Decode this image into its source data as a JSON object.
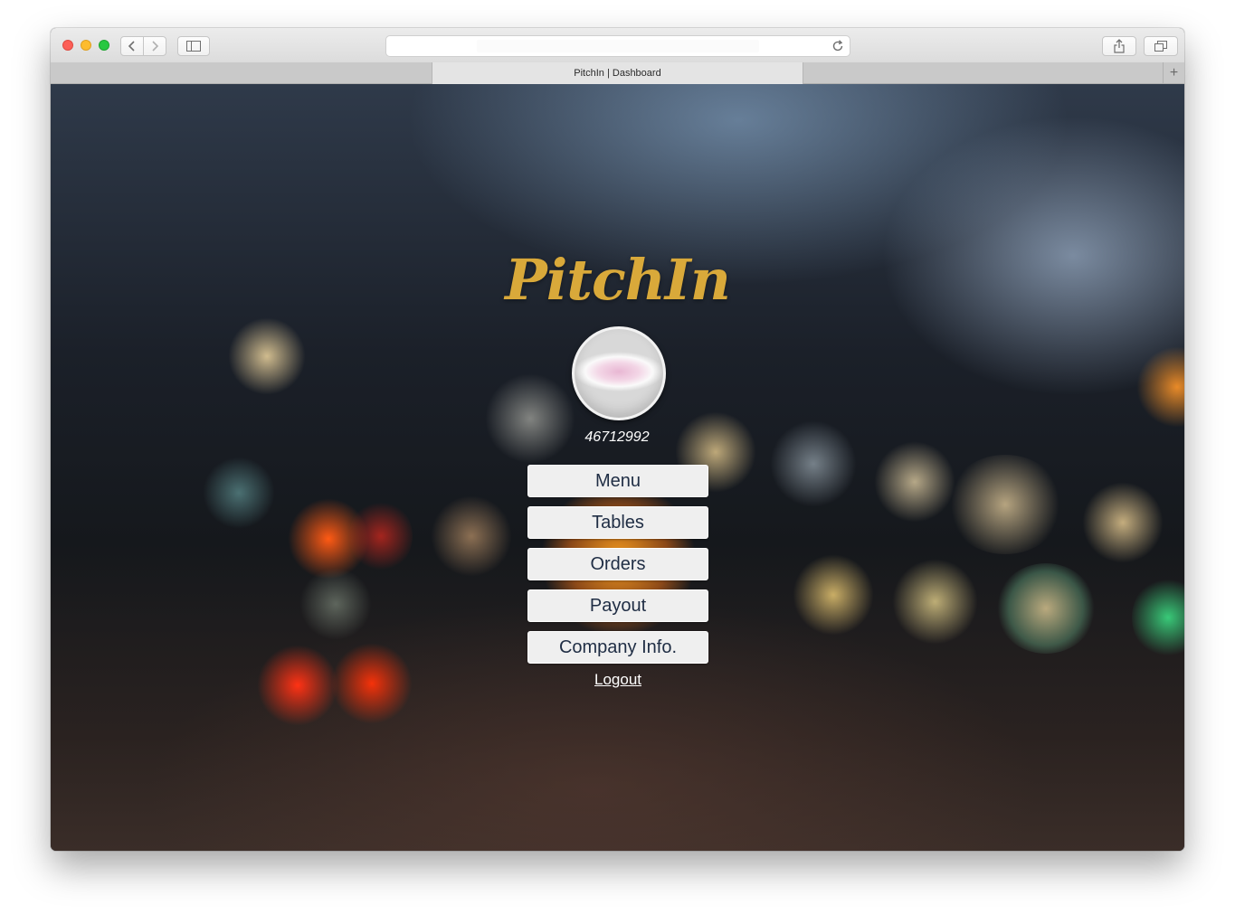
{
  "browser": {
    "tab_title": "PitchIn | Dashboard",
    "new_tab_symbol": "+"
  },
  "brand": {
    "logo_text": "PitchIn",
    "logo_color": "#d9a93a"
  },
  "user": {
    "id": "46712992"
  },
  "nav": {
    "items": [
      {
        "label": "Menu"
      },
      {
        "label": "Tables"
      },
      {
        "label": "Orders"
      },
      {
        "label": "Payout"
      },
      {
        "label": "Company Info."
      }
    ],
    "logout_label": "Logout"
  },
  "icons": [
    "back-arrow-icon",
    "forward-arrow-icon",
    "sidebar-icon",
    "reload-icon",
    "share-icon",
    "tabs-overview-icon"
  ]
}
